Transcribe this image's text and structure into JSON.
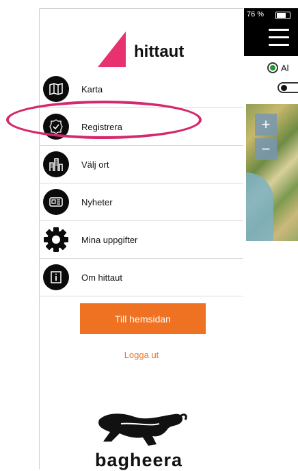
{
  "brand": {
    "logo_text": "hittaut",
    "accent": "#e8316f"
  },
  "menu": {
    "items": [
      {
        "label": "Karta",
        "icon": "map-icon"
      },
      {
        "label": "Registrera",
        "icon": "check-badge-icon"
      },
      {
        "label": "Välj ort",
        "icon": "city-icon"
      },
      {
        "label": "Nyheter",
        "icon": "newspaper-icon"
      },
      {
        "label": "Mina uppgifter",
        "icon": "gear-icon"
      },
      {
        "label": "Om hittaut",
        "icon": "info-icon"
      }
    ]
  },
  "actions": {
    "home_button": "Till hemsidan",
    "logout_link": "Logga ut",
    "button_color": "#ee7222"
  },
  "sponsor": {
    "name": "bagheera"
  },
  "status": {
    "battery": "76 %"
  },
  "map_panel": {
    "radio_label": "Al",
    "zoom_in": "+",
    "zoom_out": "−"
  },
  "highlight_color": "#d6296b"
}
